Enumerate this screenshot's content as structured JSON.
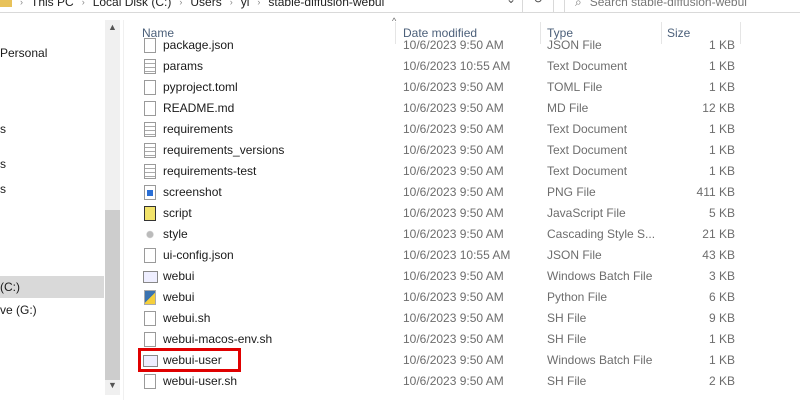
{
  "breadcrumb": [
    "This PC",
    "Local Disk (C:)",
    "Users",
    "yi",
    "stable-diffusion-webui"
  ],
  "search": {
    "placeholder": "Search stable-diffusion-webui"
  },
  "nav": [
    {
      "label": "Personal"
    },
    {
      "label": "s"
    },
    {
      "label": "s"
    },
    {
      "label": "s"
    },
    {
      "label": "(C:)",
      "selected": true
    },
    {
      "label": "ve (G:)"
    }
  ],
  "columns": {
    "name": "Name",
    "date": "Date modified",
    "type": "Type",
    "size": "Size"
  },
  "files": [
    {
      "name": "package.json",
      "date": "10/6/2023 9:50 AM",
      "type": "JSON File",
      "size": "1 KB",
      "icon": "file"
    },
    {
      "name": "params",
      "date": "10/6/2023 10:55 AM",
      "type": "Text Document",
      "size": "1 KB",
      "icon": "txt"
    },
    {
      "name": "pyproject.toml",
      "date": "10/6/2023 9:50 AM",
      "type": "TOML File",
      "size": "1 KB",
      "icon": "file"
    },
    {
      "name": "README.md",
      "date": "10/6/2023 9:50 AM",
      "type": "MD File",
      "size": "12 KB",
      "icon": "file"
    },
    {
      "name": "requirements",
      "date": "10/6/2023 9:50 AM",
      "type": "Text Document",
      "size": "1 KB",
      "icon": "txt"
    },
    {
      "name": "requirements_versions",
      "date": "10/6/2023 9:50 AM",
      "type": "Text Document",
      "size": "1 KB",
      "icon": "txt"
    },
    {
      "name": "requirements-test",
      "date": "10/6/2023 9:50 AM",
      "type": "Text Document",
      "size": "1 KB",
      "icon": "txt"
    },
    {
      "name": "screenshot",
      "date": "10/6/2023 9:50 AM",
      "type": "PNG File",
      "size": "411 KB",
      "icon": "png"
    },
    {
      "name": "script",
      "date": "10/6/2023 9:50 AM",
      "type": "JavaScript File",
      "size": "5 KB",
      "icon": "js"
    },
    {
      "name": "style",
      "date": "10/6/2023 9:50 AM",
      "type": "Cascading Style S...",
      "size": "21 KB",
      "icon": "css"
    },
    {
      "name": "ui-config.json",
      "date": "10/6/2023 10:55 AM",
      "type": "JSON File",
      "size": "43 KB",
      "icon": "file"
    },
    {
      "name": "webui",
      "date": "10/6/2023 9:50 AM",
      "type": "Windows Batch File",
      "size": "3 KB",
      "icon": "bat"
    },
    {
      "name": "webui",
      "date": "10/6/2023 9:50 AM",
      "type": "Python File",
      "size": "6 KB",
      "icon": "py"
    },
    {
      "name": "webui.sh",
      "date": "10/6/2023 9:50 AM",
      "type": "SH File",
      "size": "9 KB",
      "icon": "file"
    },
    {
      "name": "webui-macos-env.sh",
      "date": "10/6/2023 9:50 AM",
      "type": "SH File",
      "size": "1 KB",
      "icon": "file"
    },
    {
      "name": "webui-user",
      "date": "10/6/2023 9:50 AM",
      "type": "Windows Batch File",
      "size": "1 KB",
      "icon": "bat",
      "highlighted": true
    },
    {
      "name": "webui-user.sh",
      "date": "10/6/2023 9:50 AM",
      "type": "SH File",
      "size": "2 KB",
      "icon": "file"
    }
  ],
  "highlight_color": "#e00000"
}
